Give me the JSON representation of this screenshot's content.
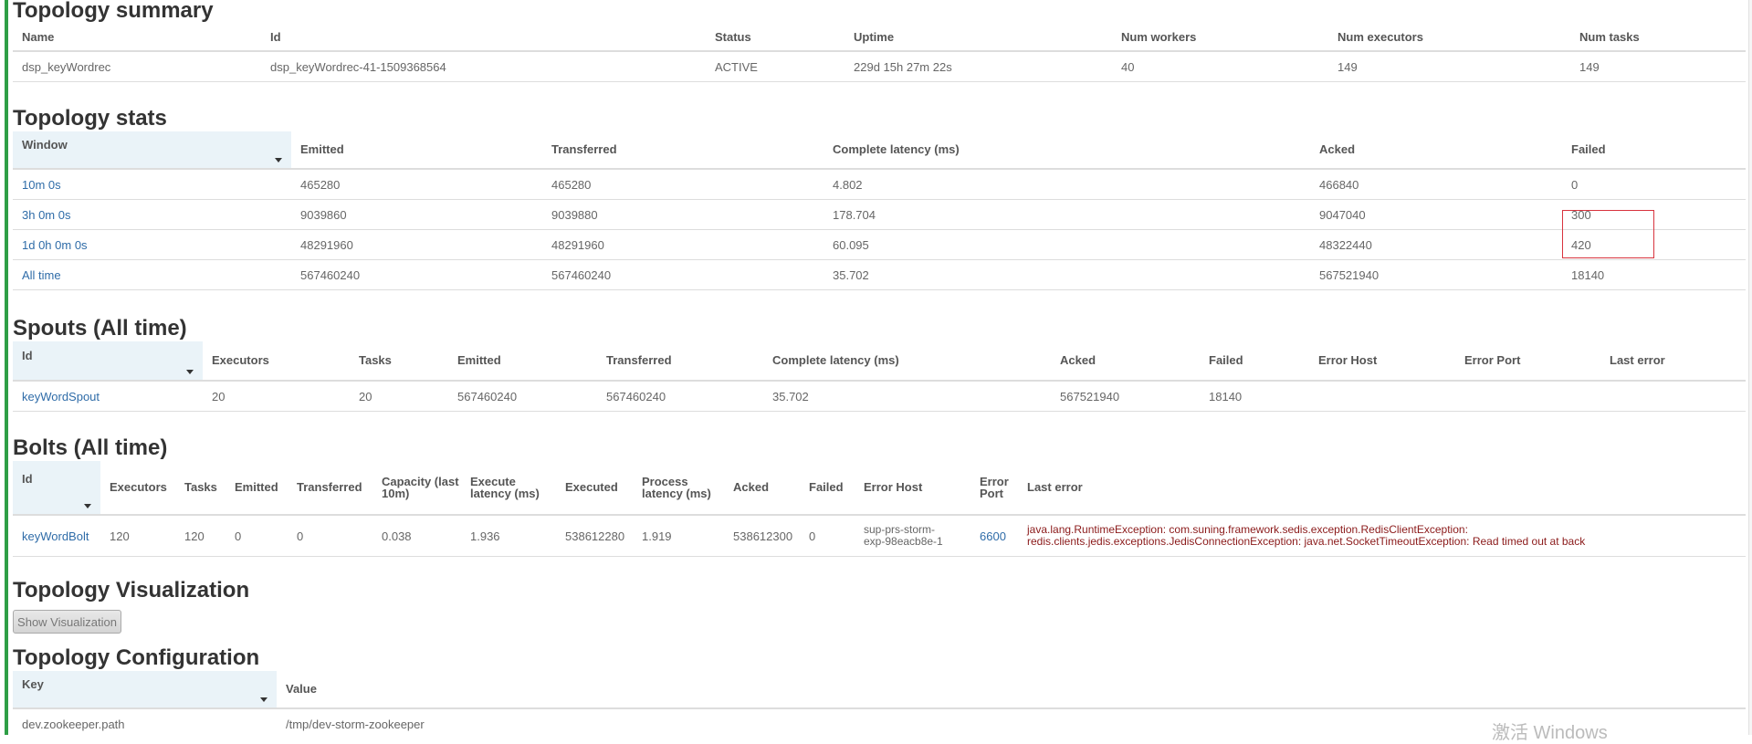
{
  "summary": {
    "title": "Topology summary",
    "headers": [
      "Name",
      "Id",
      "Status",
      "Uptime",
      "Num workers",
      "Num executors",
      "Num tasks"
    ],
    "row": [
      "dsp_keyWordrec",
      "dsp_keyWordrec-41-1509368564",
      "ACTIVE",
      "229d 15h 27m 22s",
      "40",
      "149",
      "149"
    ]
  },
  "stats": {
    "title": "Topology stats",
    "headers": [
      "Window",
      "Emitted",
      "Transferred",
      "Complete latency (ms)",
      "Acked",
      "Failed"
    ],
    "rows": [
      [
        "10m 0s",
        "465280",
        "465280",
        "4.802",
        "466840",
        "0"
      ],
      [
        "3h 0m 0s",
        "9039860",
        "9039880",
        "178.704",
        "9047040",
        "300"
      ],
      [
        "1d 0h 0m 0s",
        "48291960",
        "48291960",
        "60.095",
        "48322440",
        "420"
      ],
      [
        "All time",
        "567460240",
        "567460240",
        "35.702",
        "567521940",
        "18140"
      ]
    ]
  },
  "spouts": {
    "title": "Spouts (All time)",
    "headers": [
      "Id",
      "Executors",
      "Tasks",
      "Emitted",
      "Transferred",
      "Complete latency (ms)",
      "Acked",
      "Failed",
      "Error Host",
      "Error Port",
      "Last error"
    ],
    "row": [
      "keyWordSpout",
      "20",
      "20",
      "567460240",
      "567460240",
      "35.702",
      "567521940",
      "18140",
      "",
      "",
      ""
    ]
  },
  "bolts": {
    "title": "Bolts (All time)",
    "headers": [
      "Id",
      "Executors",
      "Tasks",
      "Emitted",
      "Transferred",
      "Capacity (last 10m)",
      "Execute latency (ms)",
      "Executed",
      "Process latency (ms)",
      "Acked",
      "Failed",
      "Error Host",
      "Error Port",
      "Last error"
    ],
    "row": [
      "keyWordBolt",
      "120",
      "120",
      "0",
      "0",
      "0.038",
      "1.936",
      "538612280",
      "1.919",
      "538612300",
      "0",
      "sup-prs-storm-exp-98eacb8e-1",
      "6600",
      "java.lang.RuntimeException: com.suning.framework.sedis.exception.RedisClientException: redis.clients.jedis.exceptions.JedisConnectionException: java.net.SocketTimeoutException: Read timed out at back"
    ]
  },
  "visualization": {
    "title": "Topology Visualization",
    "button_label": "Show Visualization"
  },
  "configuration": {
    "title": "Topology Configuration",
    "headers": [
      "Key",
      "Value"
    ],
    "row": [
      "dev.zookeeper.path",
      "/tmp/dev-storm-zookeeper"
    ]
  },
  "watermark": "激活 Windows",
  "colors": {
    "accent_bar": "#2e9e46",
    "link": "#2f6ca8",
    "error_text": "#8b1a1a",
    "highlight_box": "#d8343e",
    "sorted_header_bg": "#eaf3f8"
  }
}
